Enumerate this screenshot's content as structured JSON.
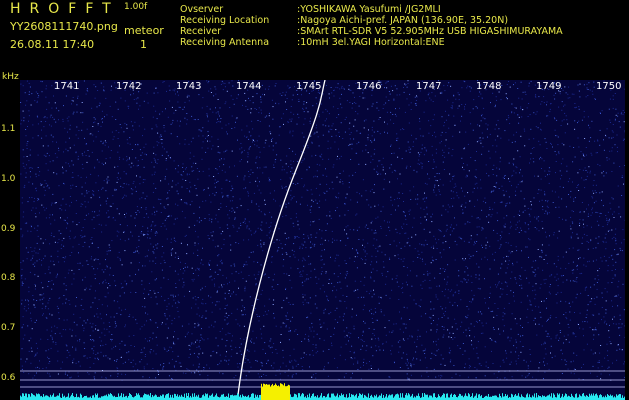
{
  "header": {
    "app_title": "HROFFT",
    "version": "1.00f",
    "filename": "YY2608111740.png",
    "datetime": "26.08.11 17:40",
    "mode_label": "meteor",
    "count": "1"
  },
  "info": [
    {
      "key": "Ovserver",
      "value": ":YOSHIKAWA Yasufumi /JG2MLI"
    },
    {
      "key": "Receiving Location",
      "value": ":Nagoya Aichi-pref. JAPAN (136.90E, 35.20N)"
    },
    {
      "key": "Receiver",
      "value": ":SMArt RTL-SDR V5 52.905MHz USB HIGASHIMURAYAMA"
    },
    {
      "key": "Receiving Antenna",
      "value": ":10mH 3el.YAGI Horizontal:ENE"
    }
  ],
  "axis": {
    "y_unit": "kHz",
    "y_ticks": [
      "1.1",
      "1.0",
      "0.9",
      "0.8",
      "0.7",
      "0.6"
    ],
    "x_ticks": [
      "1741",
      "1742",
      "1743",
      "1744",
      "1745",
      "1746",
      "1747",
      "1748",
      "1749",
      "1750"
    ]
  },
  "colors": {
    "background": "#05053a",
    "noise": "#3a55c8",
    "trace": "#ffffff",
    "baseline": "#28e8f0",
    "signal": "#f5f000",
    "label": "#e8e84a"
  }
}
